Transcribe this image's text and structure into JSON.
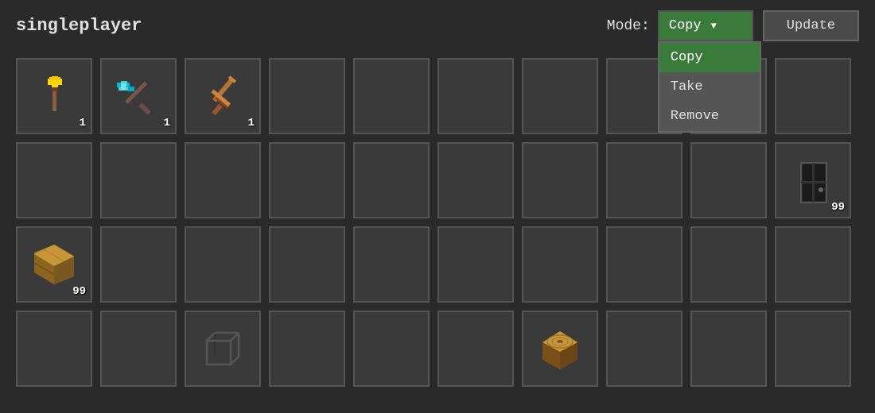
{
  "header": {
    "title": "singleplayer",
    "mode_label": "Mode:",
    "mode_selected": "Copy",
    "update_button": "Update",
    "dropdown_options": [
      {
        "label": "Copy",
        "selected": true
      },
      {
        "label": "Take",
        "selected": false
      },
      {
        "label": "Remove",
        "selected": false
      }
    ]
  },
  "grid": {
    "rows": 4,
    "cols": 10,
    "cells": [
      {
        "row": 0,
        "col": 0,
        "item": "golden_shovel",
        "count": "1"
      },
      {
        "row": 0,
        "col": 1,
        "item": "diamond_pickaxe",
        "count": "1"
      },
      {
        "row": 0,
        "col": 2,
        "item": "iron_sword",
        "count": "1"
      },
      {
        "row": 0,
        "col": 3,
        "item": null
      },
      {
        "row": 0,
        "col": 4,
        "item": null
      },
      {
        "row": 0,
        "col": 5,
        "item": null
      },
      {
        "row": 0,
        "col": 6,
        "item": null
      },
      {
        "row": 0,
        "col": 7,
        "item": null
      },
      {
        "row": 0,
        "col": 8,
        "item": null
      },
      {
        "row": 0,
        "col": 9,
        "item": null
      },
      {
        "row": 1,
        "col": 0,
        "item": null
      },
      {
        "row": 1,
        "col": 1,
        "item": null
      },
      {
        "row": 1,
        "col": 2,
        "item": null
      },
      {
        "row": 1,
        "col": 3,
        "item": null
      },
      {
        "row": 1,
        "col": 4,
        "item": null
      },
      {
        "row": 1,
        "col": 5,
        "item": null
      },
      {
        "row": 1,
        "col": 6,
        "item": null
      },
      {
        "row": 1,
        "col": 7,
        "item": null
      },
      {
        "row": 1,
        "col": 8,
        "item": null
      },
      {
        "row": 1,
        "col": 9,
        "item": "dark_door",
        "count": "99"
      },
      {
        "row": 2,
        "col": 0,
        "item": "wood_planks",
        "count": "99"
      },
      {
        "row": 2,
        "col": 1,
        "item": null
      },
      {
        "row": 2,
        "col": 2,
        "item": null
      },
      {
        "row": 2,
        "col": 3,
        "item": null
      },
      {
        "row": 2,
        "col": 4,
        "item": null
      },
      {
        "row": 2,
        "col": 5,
        "item": null
      },
      {
        "row": 2,
        "col": 6,
        "item": null
      },
      {
        "row": 2,
        "col": 7,
        "item": null
      },
      {
        "row": 2,
        "col": 8,
        "item": null
      },
      {
        "row": 2,
        "col": 9,
        "item": null
      },
      {
        "row": 3,
        "col": 0,
        "item": null
      },
      {
        "row": 3,
        "col": 1,
        "item": null
      },
      {
        "row": 3,
        "col": 2,
        "item": "cube_outline",
        "count": null
      },
      {
        "row": 3,
        "col": 3,
        "item": null
      },
      {
        "row": 3,
        "col": 4,
        "item": null
      },
      {
        "row": 3,
        "col": 5,
        "item": null
      },
      {
        "row": 3,
        "col": 6,
        "item": "wood_log_top",
        "count": null
      },
      {
        "row": 3,
        "col": 7,
        "item": null
      },
      {
        "row": 3,
        "col": 8,
        "item": null
      },
      {
        "row": 3,
        "col": 9,
        "item": null
      }
    ]
  }
}
